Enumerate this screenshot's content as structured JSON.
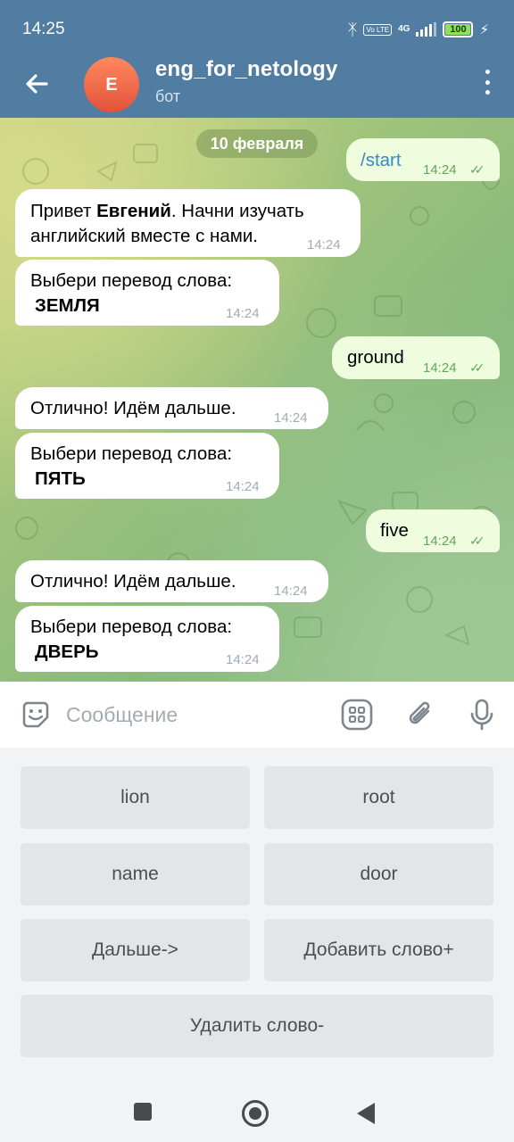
{
  "status": {
    "time": "14:25",
    "volte": "Vo LTE",
    "network": "4G",
    "battery": "100"
  },
  "header": {
    "avatar_letter": "E",
    "title": "eng_for_netology",
    "subtitle": "бот"
  },
  "chat": {
    "date": "10 февраля",
    "messages": [
      {
        "dir": "out",
        "text": "/start",
        "time": "14:24"
      },
      {
        "dir": "in",
        "text_pre": "Привет ",
        "text_bold": "Евгений",
        "text_post": ". Начни изучать английский вместе с нами.",
        "time": "14:24"
      },
      {
        "dir": "in",
        "text": "Выбери перевод слова:",
        "word": "ЗЕМЛЯ",
        "time": "14:24"
      },
      {
        "dir": "out",
        "text": "ground",
        "time": "14:24"
      },
      {
        "dir": "in",
        "text": "Отлично! Идём дальше.",
        "time": "14:24"
      },
      {
        "dir": "in",
        "text": "Выбери перевод слова:",
        "word": "ПЯТЬ",
        "time": "14:24"
      },
      {
        "dir": "out",
        "text": "five",
        "time": "14:24"
      },
      {
        "dir": "in",
        "text": "Отлично! Идём дальше.",
        "time": "14:24"
      },
      {
        "dir": "in",
        "text": "Выбери перевод слова:",
        "word": "ДВЕРЬ",
        "time": "14:24"
      }
    ]
  },
  "input": {
    "placeholder": "Сообщение"
  },
  "keyboard": {
    "buttons": [
      "lion",
      "root",
      "name",
      "door",
      "Дальше->",
      "Добавить слово+",
      "Удалить слово-"
    ]
  },
  "icons": {
    "back": "arrow-left-icon",
    "menu": "more-vertical-icon",
    "emoji": "sticker-icon",
    "commands": "bot-keyboard-icon",
    "attach": "paperclip-icon",
    "mic": "microphone-icon"
  },
  "colors": {
    "header": "#517da2",
    "outgoing_bubble": "#effdde",
    "incoming_bubble": "#ffffff",
    "check": "#5fa75a",
    "avatar": "#e2523a"
  }
}
